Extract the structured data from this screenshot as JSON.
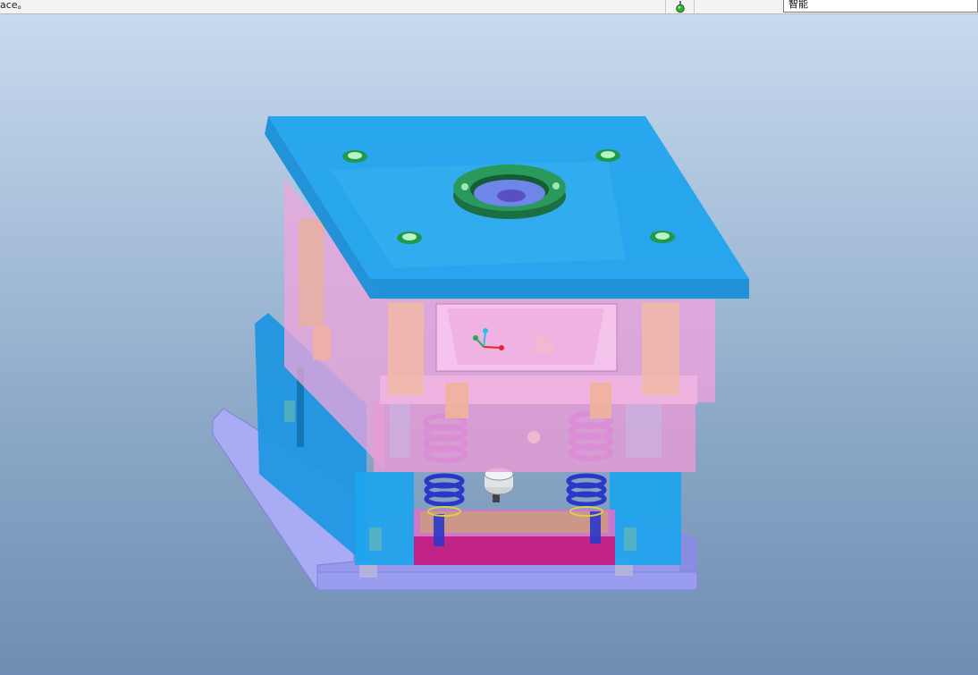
{
  "status_bar": {
    "message": "ace。",
    "filter_value": "智能"
  },
  "icons": {
    "status_light": "green-light-icon",
    "csys": "coordinate-system-icon"
  },
  "colors": {
    "top_plate": "#1ea4ee",
    "cavity_plate": "#ee9ad6",
    "core_plate": "#1ea4ee",
    "bottom_plate": "#9a9cef",
    "locating_ring": "#1f8a55",
    "springs": "#2a38c9",
    "ejector_plate": "#c0157a"
  }
}
